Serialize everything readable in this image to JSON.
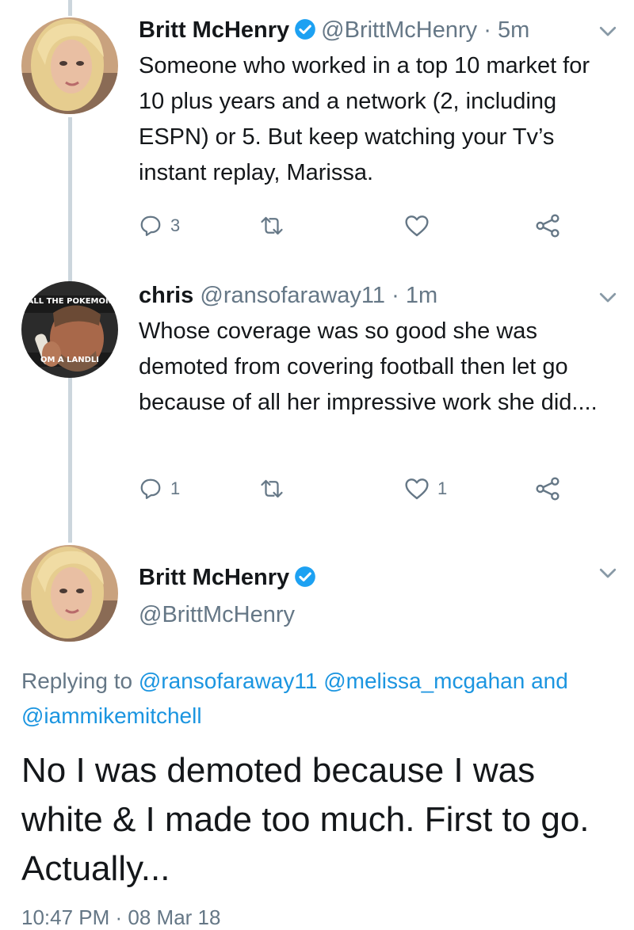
{
  "tweet1": {
    "name": "Britt McHenry",
    "handle": "@BrittMcHenry",
    "separator": "·",
    "time": "5m",
    "text": "Someone who worked in a top 10 market for 10 plus years and a network (2, including ESPN) or 5. But keep watching your Tv’s instant replay, Marissa.",
    "reply_count": "3",
    "retweet_count": "",
    "like_count": ""
  },
  "tweet2": {
    "name": "chris",
    "handle": "@ransofaraway11",
    "separator": "·",
    "time": "1m",
    "text": "Whose coverage was so good she was demoted from covering football then let go because of all her impressive work she did....",
    "reply_count": "1",
    "retweet_count": "",
    "like_count": "1"
  },
  "main_tweet": {
    "name": "Britt McHenry",
    "handle": "@BrittMcHenry",
    "replying_prefix": "Replying to",
    "mention1": "@ransofaraway11",
    "mention2": "@melissa_mcgahan",
    "and_word": "and",
    "mention3": "@iammikemitchell",
    "text": "No I was demoted because I was white & I made too much. First to go. Actually...",
    "timestamp_partial": "10:47 PM · 08 Mar 18"
  },
  "colors": {
    "link": "#1b95e0",
    "secondary": "#657786",
    "verified": "#1da1f2",
    "thread_line": "#ccd6dd"
  }
}
